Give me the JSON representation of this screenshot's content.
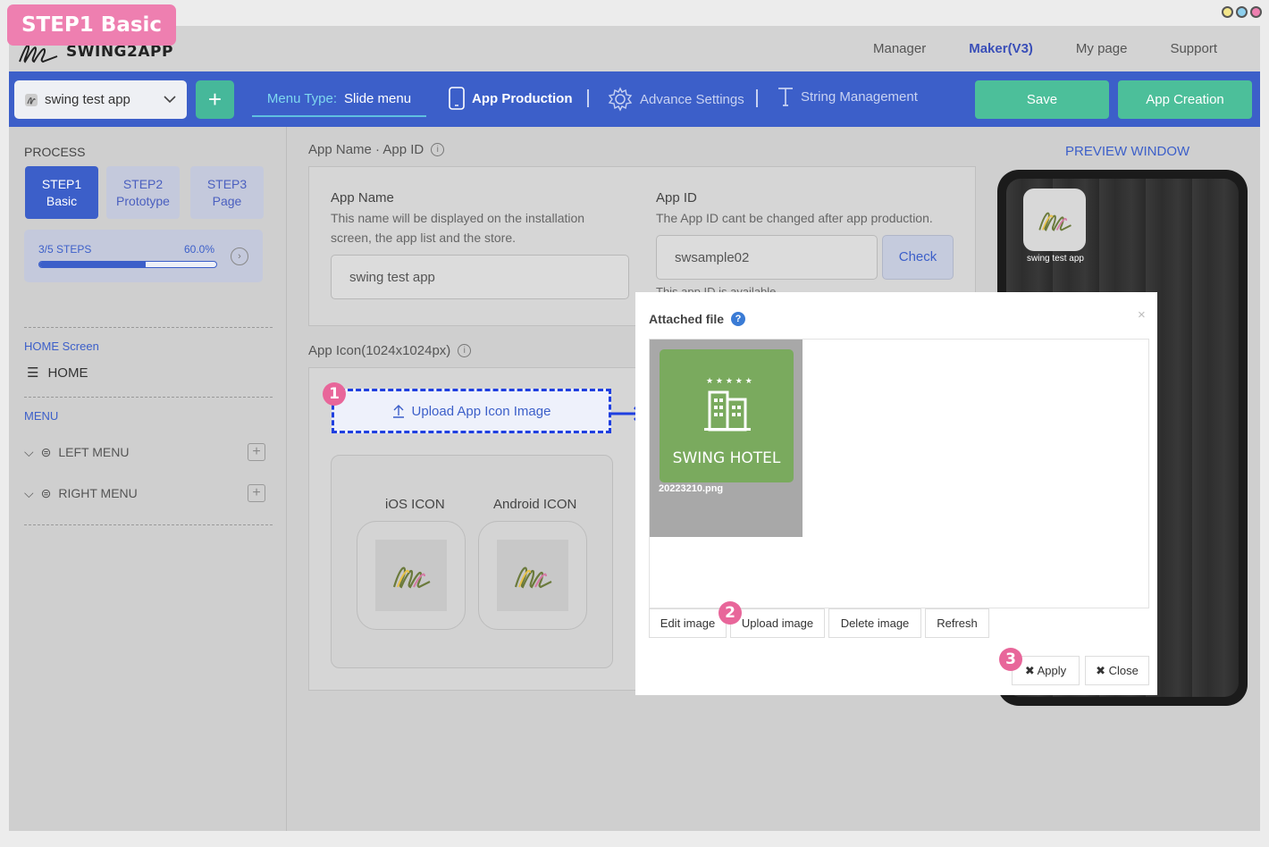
{
  "step_tag": "STEP1 Basic",
  "brand": {
    "name": "SWING2APP"
  },
  "nav": [
    "Manager",
    "Maker(V3)",
    "My page",
    "Support"
  ],
  "toolbar": {
    "app_select": "swing test app",
    "menu_type_label": "Menu Type:",
    "menu_type_value": "Slide menu",
    "app_production": "App Production",
    "advance_settings": "Advance Settings",
    "string_management": "String Management",
    "save": "Save",
    "app_creation": "App Creation"
  },
  "left": {
    "process_title": "PROCESS",
    "steps": [
      {
        "line1": "STEP1",
        "line2": "Basic"
      },
      {
        "line1": "STEP2",
        "line2": "Prototype"
      },
      {
        "line1": "STEP3",
        "line2": "Page"
      }
    ],
    "progress_steps": "3/5 STEPS",
    "progress_percent": "60.0%",
    "progress_fraction": 0.6,
    "home_screen_label": "HOME Screen",
    "home_item": "HOME",
    "menu_label": "MENU",
    "left_menu": "LEFT MENU",
    "right_menu": "RIGHT MENU"
  },
  "main": {
    "section1_title": "App Name · App ID",
    "app_name_label": "App Name",
    "app_name_help": "This name will be displayed on the installation screen, the app list and the store.",
    "app_name_value": "swing test app",
    "app_id_label": "App ID",
    "app_id_help": "The App ID cant be changed after app production.",
    "app_id_value": "swsample02",
    "check_btn": "Check",
    "app_id_status": "This app ID is available.",
    "section2_title": "App Icon(1024x1024px)",
    "upload_btn": "Upload App Icon Image",
    "ios_icon": "iOS ICON",
    "android_icon": "Android ICON"
  },
  "preview": {
    "title": "PREVIEW WINDOW",
    "app_name": "swing test app"
  },
  "modal": {
    "title": "Attached file",
    "close_x": "×",
    "thumb_text": "SWING HOTEL",
    "file_name": "20223210.png",
    "edit_image": "Edit image",
    "upload_image": "Upload image",
    "delete_image": "Delete image",
    "refresh": "Refresh",
    "apply": "Apply",
    "close": "Close"
  },
  "badges": [
    "1",
    "2",
    "3"
  ],
  "colors": {
    "accent": "#3c5fc9",
    "green": "#4cbf9a",
    "badge": "#e8669a",
    "hotel": "#7aaa5e"
  }
}
